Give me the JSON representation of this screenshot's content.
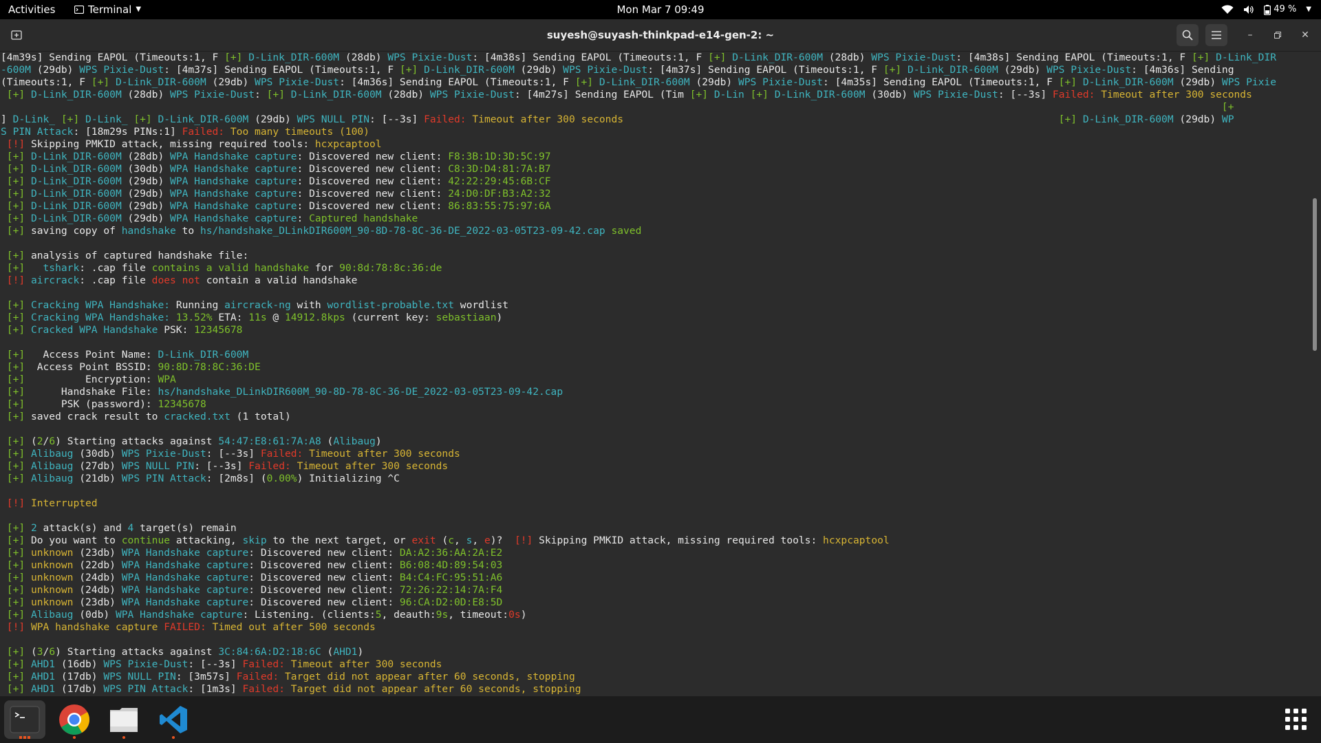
{
  "topbar": {
    "activities": "Activities",
    "app_name": "Terminal",
    "clock": "Mon Mar 7  09:49",
    "battery": "49 %"
  },
  "window": {
    "title": "suyesh@suyash-thinkpad-e14-gen-2: ~"
  },
  "colors": {
    "blue": "#3fb5c0",
    "green": "#7fc12b",
    "red": "#e23a2a",
    "yellow": "#d8b534",
    "white": "#e8e8e8"
  },
  "lines": [
    [
      [
        "w",
        "[4m39s] Sending EAPOL (Timeouts:1, F "
      ],
      [
        "g",
        "[+] "
      ],
      [
        "b",
        "D-Link_DIR-600M"
      ],
      [
        "w",
        " (28db) "
      ],
      [
        "b",
        "WPS Pixie-Dust"
      ],
      [
        "w",
        ": [4m38s] Sending EAPOL (Timeouts:1, F "
      ],
      [
        "g",
        "[+] "
      ],
      [
        "b",
        "D-Link_DIR-600M"
      ],
      [
        "w",
        " (28db) "
      ],
      [
        "b",
        "WPS Pixie-Dust"
      ],
      [
        "w",
        ": [4m38s] Sending EAPOL (Timeouts:1, F "
      ],
      [
        "g",
        "[+] "
      ],
      [
        "b",
        "D-Link_DIR"
      ]
    ],
    [
      [
        "b",
        "-600M"
      ],
      [
        "w",
        " (29db) "
      ],
      [
        "b",
        "WPS Pixie-Dust"
      ],
      [
        "w",
        ": [4m37s] Sending EAPOL (Timeouts:1, F "
      ],
      [
        "g",
        "[+] "
      ],
      [
        "b",
        "D-Link_DIR-600M"
      ],
      [
        "w",
        " (29db) "
      ],
      [
        "b",
        "WPS Pixie-Dust"
      ],
      [
        "w",
        ": [4m37s] Sending EAPOL (Timeouts:1, F "
      ],
      [
        "g",
        "[+] "
      ],
      [
        "b",
        "D-Link_DIR-600M"
      ],
      [
        "w",
        " (29db) "
      ],
      [
        "b",
        "WPS Pixie-Dust"
      ],
      [
        "w",
        ": [4m36s] Sending"
      ]
    ],
    [
      [
        "w",
        "(Timeouts:1, F "
      ],
      [
        "g",
        "[+] "
      ],
      [
        "b",
        "D-Link_DIR-600M"
      ],
      [
        "w",
        " (29db) "
      ],
      [
        "b",
        "WPS Pixie-Dust"
      ],
      [
        "w",
        ": [4m36s] Sending EAPOL (Timeouts:1, F "
      ],
      [
        "g",
        "[+] "
      ],
      [
        "b",
        "D-Link_DIR-600M"
      ],
      [
        "w",
        " (29db) "
      ],
      [
        "b",
        "WPS Pixie-Dust"
      ],
      [
        "w",
        ": [4m35s] Sending EAPOL (Timeouts:1, F "
      ],
      [
        "g",
        "[+] "
      ],
      [
        "b",
        "D-Link_DIR-600M"
      ],
      [
        "w",
        " (29db) "
      ],
      [
        "b",
        "WPS Pixie"
      ]
    ],
    [
      [
        "g",
        " [+] "
      ],
      [
        "b",
        "D-Link_DIR-600M"
      ],
      [
        "w",
        " (28db) "
      ],
      [
        "b",
        "WPS Pixie-Dust"
      ],
      [
        "w",
        ": "
      ],
      [
        "g",
        "[+] "
      ],
      [
        "b",
        "D-Link_DIR-600M"
      ],
      [
        "w",
        " (28db) "
      ],
      [
        "b",
        "WPS Pixie-Dust"
      ],
      [
        "w",
        ": [4m27s] Sending EAPOL (Tim "
      ],
      [
        "g",
        "[+] "
      ],
      [
        "b",
        "D-Lin "
      ],
      [
        "g",
        "[+] "
      ],
      [
        "b",
        "D-Link_DIR-600M"
      ],
      [
        "w",
        " (30db) "
      ],
      [
        "b",
        "WPS Pixie-Dust"
      ],
      [
        "w",
        ": [--3s] "
      ],
      [
        "r",
        "Failed: "
      ],
      [
        "y",
        "Timeout after 300 seconds"
      ]
    ],
    [
      [
        "g",
        "                                                                                                                                                                                                          [+"
      ]
    ],
    [
      [
        "w",
        "] "
      ],
      [
        "b",
        "D-Link_ "
      ],
      [
        "g",
        "[+] "
      ],
      [
        "b",
        "D-Link_ "
      ],
      [
        "g",
        "[+] "
      ],
      [
        "b",
        "D-Link_DIR-600M"
      ],
      [
        "w",
        " (29db) "
      ],
      [
        "b",
        "WPS NULL PIN"
      ],
      [
        "w",
        ": [--3s] "
      ],
      [
        "r",
        "Failed: "
      ],
      [
        "y",
        "Timeout after 300 seconds"
      ],
      [
        "w",
        "                                                                        "
      ],
      [
        "g",
        "[+] "
      ],
      [
        "b",
        "D-Link_DIR-600M"
      ],
      [
        "w",
        " (29db) "
      ],
      [
        "b",
        "WP"
      ]
    ],
    [
      [
        "b",
        "S PIN Attack"
      ],
      [
        "w",
        ": [18m29s PINs:1] "
      ],
      [
        "r",
        "Failed: "
      ],
      [
        "y",
        "Too many timeouts (100)"
      ]
    ],
    [
      [
        "r",
        " [!] "
      ],
      [
        "w",
        "Skipping PMKID attack, missing required tools: "
      ],
      [
        "y",
        "hcxpcaptool"
      ]
    ],
    [
      [
        "g",
        " [+] "
      ],
      [
        "b",
        "D-Link_DIR-600M"
      ],
      [
        "w",
        " (28db) "
      ],
      [
        "b",
        "WPA Handshake capture"
      ],
      [
        "w",
        ": Discovered new client: "
      ],
      [
        "g",
        "F8:3B:1D:3D:5C:97"
      ]
    ],
    [
      [
        "g",
        " [+] "
      ],
      [
        "b",
        "D-Link_DIR-600M"
      ],
      [
        "w",
        " (30db) "
      ],
      [
        "b",
        "WPA Handshake capture"
      ],
      [
        "w",
        ": Discovered new client: "
      ],
      [
        "g",
        "C8:3D:D4:81:7A:B7"
      ]
    ],
    [
      [
        "g",
        " [+] "
      ],
      [
        "b",
        "D-Link_DIR-600M"
      ],
      [
        "w",
        " (29db) "
      ],
      [
        "b",
        "WPA Handshake capture"
      ],
      [
        "w",
        ": Discovered new client: "
      ],
      [
        "g",
        "42:22:29:45:6B:CF"
      ]
    ],
    [
      [
        "g",
        " [+] "
      ],
      [
        "b",
        "D-Link_DIR-600M"
      ],
      [
        "w",
        " (29db) "
      ],
      [
        "b",
        "WPA Handshake capture"
      ],
      [
        "w",
        ": Discovered new client: "
      ],
      [
        "g",
        "24:D0:DF:B3:A2:32"
      ]
    ],
    [
      [
        "g",
        " [+] "
      ],
      [
        "b",
        "D-Link_DIR-600M"
      ],
      [
        "w",
        " (29db) "
      ],
      [
        "b",
        "WPA Handshake capture"
      ],
      [
        "w",
        ": Discovered new client: "
      ],
      [
        "g",
        "86:83:55:75:97:6A"
      ]
    ],
    [
      [
        "g",
        " [+] "
      ],
      [
        "b",
        "D-Link_DIR-600M"
      ],
      [
        "w",
        " (29db) "
      ],
      [
        "b",
        "WPA Handshake capture"
      ],
      [
        "w",
        ": "
      ],
      [
        "g",
        "Captured handshake"
      ]
    ],
    [
      [
        "g",
        " [+] "
      ],
      [
        "w",
        "saving copy of "
      ],
      [
        "b",
        "handshake"
      ],
      [
        "w",
        " to "
      ],
      [
        "b",
        "hs/handshake_DLinkDIR600M_90-8D-78-8C-36-DE_2022-03-05T23-09-42.cap"
      ],
      [
        "g",
        " saved"
      ]
    ],
    [],
    [
      [
        "g",
        " [+] "
      ],
      [
        "w",
        "analysis of captured handshake file:"
      ]
    ],
    [
      [
        "g",
        " [+] "
      ],
      [
        "b",
        "  tshark"
      ],
      [
        "w",
        ": .cap file "
      ],
      [
        "g",
        "contains a valid handshake"
      ],
      [
        "w",
        " for "
      ],
      [
        "g",
        "90:8d:78:8c:36:de"
      ]
    ],
    [
      [
        "r",
        " [!] "
      ],
      [
        "b",
        "aircrack"
      ],
      [
        "w",
        ": .cap file "
      ],
      [
        "r",
        "does not"
      ],
      [
        "w",
        " contain a valid handshake"
      ]
    ],
    [],
    [
      [
        "g",
        " [+] "
      ],
      [
        "b",
        "Cracking WPA Handshake:"
      ],
      [
        "w",
        " Running "
      ],
      [
        "b",
        "aircrack-ng"
      ],
      [
        "w",
        " with "
      ],
      [
        "b",
        "wordlist-probable.txt"
      ],
      [
        "w",
        " wordlist"
      ]
    ],
    [
      [
        "g",
        " [+] "
      ],
      [
        "b",
        "Cracking WPA Handshake: "
      ],
      [
        "g",
        "13.52%"
      ],
      [
        "w",
        " ETA: "
      ],
      [
        "g",
        "11s"
      ],
      [
        "w",
        " @ "
      ],
      [
        "g",
        "14912.8kps"
      ],
      [
        "w",
        " (current key: "
      ],
      [
        "g",
        "sebastiaan"
      ],
      [
        "w",
        ")"
      ]
    ],
    [
      [
        "g",
        " [+] "
      ],
      [
        "b",
        "Cracked WPA Handshake"
      ],
      [
        "w",
        " PSK: "
      ],
      [
        "g",
        "12345678"
      ]
    ],
    [],
    [
      [
        "g",
        " [+] "
      ],
      [
        "w",
        "  Access Point Name: "
      ],
      [
        "b",
        "D-Link_DIR-600M"
      ]
    ],
    [
      [
        "g",
        " [+] "
      ],
      [
        "w",
        " Access Point BSSID: "
      ],
      [
        "g",
        "90:8D:78:8C:36:DE"
      ]
    ],
    [
      [
        "g",
        " [+] "
      ],
      [
        "w",
        "         Encryption: "
      ],
      [
        "g",
        "WPA"
      ]
    ],
    [
      [
        "g",
        " [+] "
      ],
      [
        "w",
        "     Handshake File: "
      ],
      [
        "b",
        "hs/handshake_DLinkDIR600M_90-8D-78-8C-36-DE_2022-03-05T23-09-42.cap"
      ]
    ],
    [
      [
        "g",
        " [+] "
      ],
      [
        "w",
        "     PSK (password): "
      ],
      [
        "g",
        "12345678"
      ]
    ],
    [
      [
        "g",
        " [+] "
      ],
      [
        "w",
        "saved crack result to "
      ],
      [
        "b",
        "cracked.txt"
      ],
      [
        "w",
        " (1 total)"
      ]
    ],
    [],
    [
      [
        "g",
        " [+] "
      ],
      [
        "w",
        "("
      ],
      [
        "g",
        "2"
      ],
      [
        "w",
        "/"
      ],
      [
        "g",
        "6"
      ],
      [
        "w",
        ") Starting attacks against "
      ],
      [
        "b",
        "54:47:E8:61:7A:A8"
      ],
      [
        "w",
        " ("
      ],
      [
        "b",
        "Alibaug"
      ],
      [
        "w",
        ")"
      ]
    ],
    [
      [
        "g",
        " [+] "
      ],
      [
        "b",
        "Alibaug"
      ],
      [
        "w",
        " (30db) "
      ],
      [
        "b",
        "WPS Pixie-Dust"
      ],
      [
        "w",
        ": [--3s] "
      ],
      [
        "r",
        "Failed: "
      ],
      [
        "y",
        "Timeout after 300 seconds"
      ]
    ],
    [
      [
        "g",
        " [+] "
      ],
      [
        "b",
        "Alibaug"
      ],
      [
        "w",
        " (27db) "
      ],
      [
        "b",
        "WPS NULL PIN"
      ],
      [
        "w",
        ": [--3s] "
      ],
      [
        "r",
        "Failed: "
      ],
      [
        "y",
        "Timeout after 300 seconds"
      ]
    ],
    [
      [
        "g",
        " [+] "
      ],
      [
        "b",
        "Alibaug"
      ],
      [
        "w",
        " (21db) "
      ],
      [
        "b",
        "WPS PIN Attack"
      ],
      [
        "w",
        ": [2m8s] ("
      ],
      [
        "g",
        "0.00%"
      ],
      [
        "w",
        ") Initializing ^C"
      ]
    ],
    [],
    [
      [
        "r",
        " [!] "
      ],
      [
        "y",
        "Interrupted"
      ]
    ],
    [],
    [
      [
        "g",
        " [+] "
      ],
      [
        "b",
        "2"
      ],
      [
        "w",
        " attack(s) and "
      ],
      [
        "b",
        "4"
      ],
      [
        "w",
        " target(s) remain"
      ]
    ],
    [
      [
        "g",
        " [+] "
      ],
      [
        "w",
        "Do you want to "
      ],
      [
        "g",
        "continue"
      ],
      [
        "w",
        " attacking, "
      ],
      [
        "b",
        "skip"
      ],
      [
        "w",
        " to the next target, or "
      ],
      [
        "r",
        "exit"
      ],
      [
        "w",
        " ("
      ],
      [
        "g",
        "c"
      ],
      [
        "w",
        ", "
      ],
      [
        "b",
        "s"
      ],
      [
        "w",
        ", "
      ],
      [
        "r",
        "e"
      ],
      [
        "w",
        ")?  "
      ],
      [
        "r",
        "[!] "
      ],
      [
        "w",
        "Skipping PMKID attack, missing required tools: "
      ],
      [
        "y",
        "hcxpcaptool"
      ]
    ],
    [
      [
        "g",
        " [+] "
      ],
      [
        "y",
        "unknown"
      ],
      [
        "w",
        " (23db) "
      ],
      [
        "b",
        "WPA Handshake capture"
      ],
      [
        "w",
        ": Discovered new client: "
      ],
      [
        "g",
        "DA:A2:36:AA:2A:E2"
      ]
    ],
    [
      [
        "g",
        " [+] "
      ],
      [
        "y",
        "unknown"
      ],
      [
        "w",
        " (22db) "
      ],
      [
        "b",
        "WPA Handshake capture"
      ],
      [
        "w",
        ": Discovered new client: "
      ],
      [
        "g",
        "B6:08:4D:89:54:03"
      ]
    ],
    [
      [
        "g",
        " [+] "
      ],
      [
        "y",
        "unknown"
      ],
      [
        "w",
        " (24db) "
      ],
      [
        "b",
        "WPA Handshake capture"
      ],
      [
        "w",
        ": Discovered new client: "
      ],
      [
        "g",
        "B4:C4:FC:95:51:A6"
      ]
    ],
    [
      [
        "g",
        " [+] "
      ],
      [
        "y",
        "unknown"
      ],
      [
        "w",
        " (24db) "
      ],
      [
        "b",
        "WPA Handshake capture"
      ],
      [
        "w",
        ": Discovered new client: "
      ],
      [
        "g",
        "72:26:22:14:7A:F4"
      ]
    ],
    [
      [
        "g",
        " [+] "
      ],
      [
        "y",
        "unknown"
      ],
      [
        "w",
        " (23db) "
      ],
      [
        "b",
        "WPA Handshake capture"
      ],
      [
        "w",
        ": Discovered new client: "
      ],
      [
        "g",
        "96:CA:D2:0D:E8:5D"
      ]
    ],
    [
      [
        "g",
        " [+] "
      ],
      [
        "b",
        "Alibaug"
      ],
      [
        "w",
        " (0db) "
      ],
      [
        "b",
        "WPA Handshake capture"
      ],
      [
        "w",
        ": Listening. (clients:"
      ],
      [
        "g",
        "5"
      ],
      [
        "w",
        ", deauth:"
      ],
      [
        "g",
        "9s"
      ],
      [
        "w",
        ", timeout:"
      ],
      [
        "r",
        "0s"
      ],
      [
        "w",
        ")"
      ]
    ],
    [
      [
        "r",
        " [!] "
      ],
      [
        "y",
        "WPA handshake capture "
      ],
      [
        "r",
        "FAILED:"
      ],
      [
        "y",
        " Timed out after 500 seconds"
      ]
    ],
    [],
    [
      [
        "g",
        " [+] "
      ],
      [
        "w",
        "("
      ],
      [
        "g",
        "3"
      ],
      [
        "w",
        "/"
      ],
      [
        "g",
        "6"
      ],
      [
        "w",
        ") Starting attacks against "
      ],
      [
        "b",
        "3C:84:6A:D2:18:6C"
      ],
      [
        "w",
        " ("
      ],
      [
        "b",
        "AHD1"
      ],
      [
        "w",
        ")"
      ]
    ],
    [
      [
        "g",
        " [+] "
      ],
      [
        "b",
        "AHD1"
      ],
      [
        "w",
        " (16db) "
      ],
      [
        "b",
        "WPS Pixie-Dust"
      ],
      [
        "w",
        ": [--3s] "
      ],
      [
        "r",
        "Failed: "
      ],
      [
        "y",
        "Timeout after 300 seconds"
      ]
    ],
    [
      [
        "g",
        " [+] "
      ],
      [
        "b",
        "AHD1"
      ],
      [
        "w",
        " (17db) "
      ],
      [
        "b",
        "WPS NULL PIN"
      ],
      [
        "w",
        ": [3m57s] "
      ],
      [
        "r",
        "Failed: "
      ],
      [
        "y",
        "Target did not appear after 60 seconds, stopping"
      ]
    ],
    [
      [
        "g",
        " [+] "
      ],
      [
        "b",
        "AHD1"
      ],
      [
        "w",
        " (17db) "
      ],
      [
        "b",
        "WPS PIN Attack"
      ],
      [
        "w",
        ": [1m3s] "
      ],
      [
        "r",
        "Failed: "
      ],
      [
        "y",
        "Target did not appear after 60 seconds, stopping"
      ]
    ]
  ],
  "dock": {
    "apps": [
      "terminal-app",
      "chrome-app",
      "files-app",
      "vscode-app"
    ],
    "show_apps": "show-apps"
  }
}
